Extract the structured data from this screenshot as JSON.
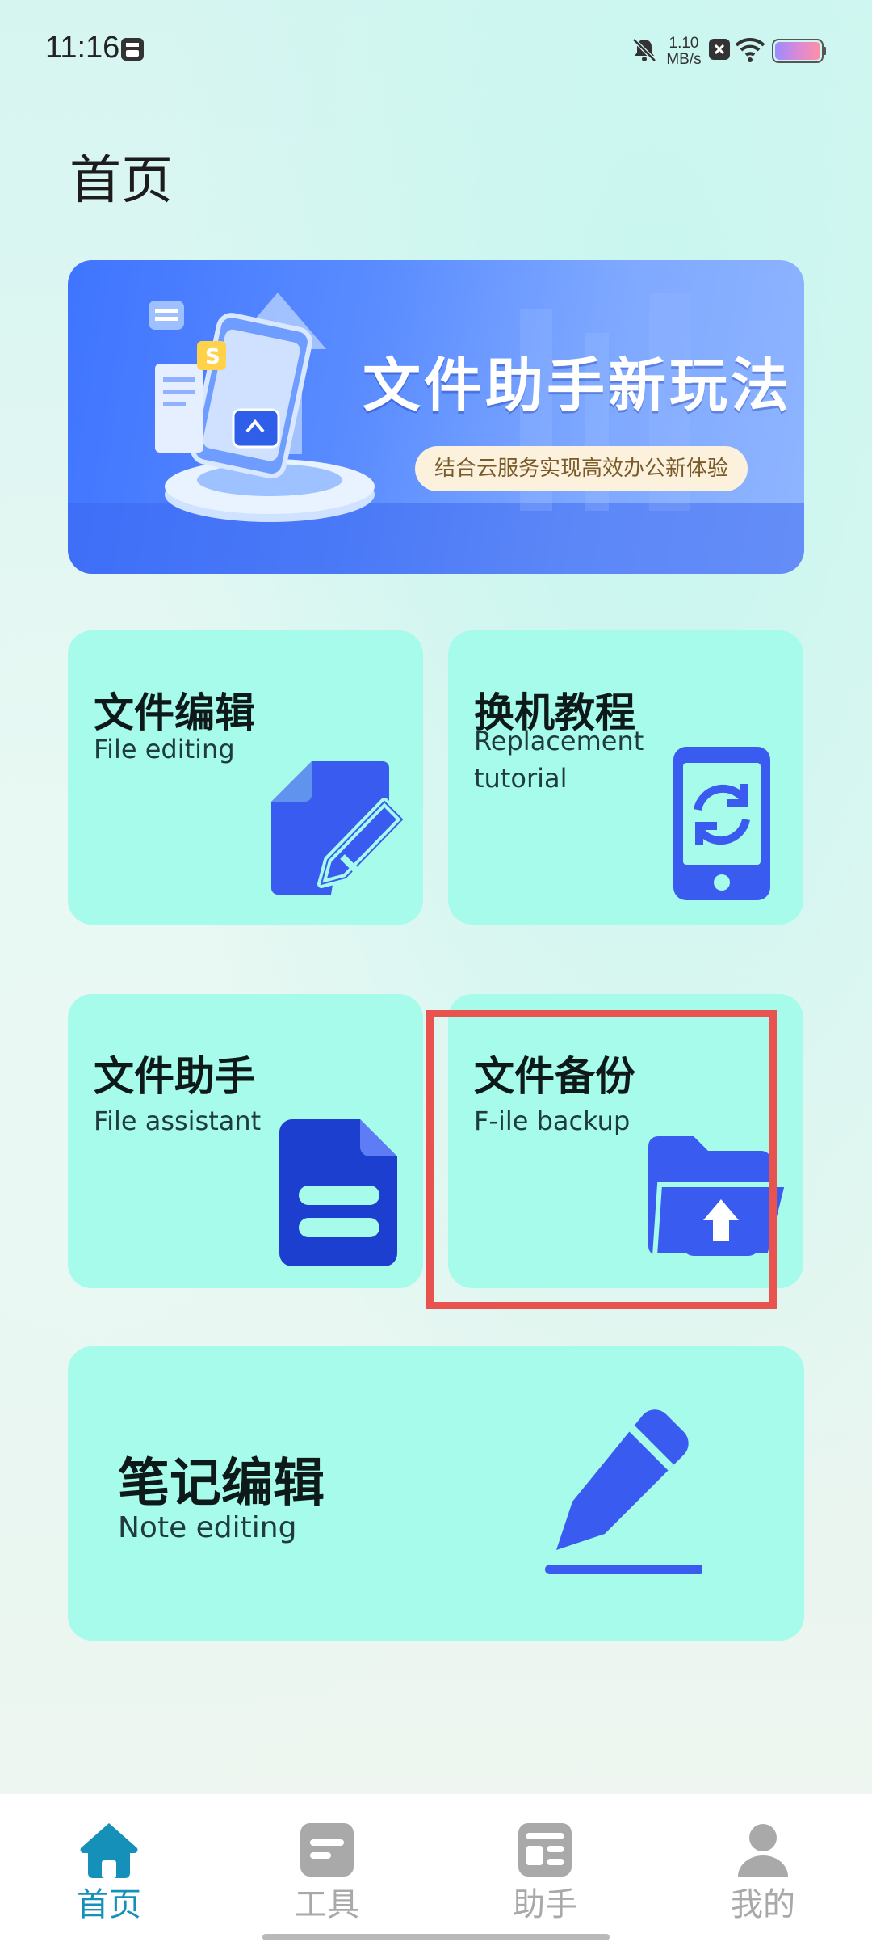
{
  "status_bar": {
    "time": "11:16",
    "net_speed_value": "1.10",
    "net_speed_unit": "MB/s"
  },
  "page": {
    "title": "首页"
  },
  "banner": {
    "title": "文件助手新玩法",
    "subtitle": "结合云服务实现高效办公新体验"
  },
  "cards": {
    "file_editing": {
      "cn": "文件编辑",
      "en": "File editing",
      "icon": "document-edit-icon"
    },
    "replacement_tutorial": {
      "cn": "换机教程",
      "en_line1": "Replacement",
      "en_line2": "tutorial",
      "icon": "phone-sync-icon"
    },
    "file_assistant": {
      "cn": "文件助手",
      "en": "File assistant",
      "icon": "document-icon"
    },
    "file_backup": {
      "cn": "文件备份",
      "en": "F-ile backup",
      "icon": "folder-upload-icon"
    },
    "note_editing": {
      "cn": "笔记编辑",
      "en": "Note editing",
      "icon": "pencil-icon"
    }
  },
  "tabbar": {
    "tabs": [
      {
        "label": "首页",
        "icon": "home-icon",
        "active": true
      },
      {
        "label": "工具",
        "icon": "tools-icon",
        "active": false
      },
      {
        "label": "助手",
        "icon": "assistant-icon",
        "active": false
      },
      {
        "label": "我的",
        "icon": "profile-icon",
        "active": false
      }
    ]
  },
  "colors": {
    "card_bg": "#a6fbea",
    "icon_blue": "#3a5bef",
    "active_tab": "#1590b9",
    "highlight": "#e8524f"
  }
}
